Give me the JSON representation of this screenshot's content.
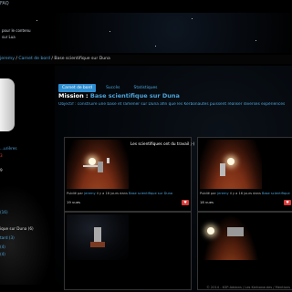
{
  "top": {
    "faq": "FAQ"
  },
  "hero": {
    "line1": "pour le contenu",
    "line2": "sur Lua"
  },
  "breadcrumb": {
    "first": "jeremy",
    "second": "Carnet de bord",
    "current": "Base scientifique sur Duna"
  },
  "sidebar": {
    "stats": [
      {
        "text": "...urières",
        "color": "blue"
      },
      {
        "text": "3",
        "color": "red"
      },
      {
        "text": "9",
        "color": "white"
      },
      {
        "text": "(16)",
        "color": "blue"
      },
      {
        "text": "ique sur Duna (6)",
        "color": "white"
      },
      {
        "text": "tard (3)",
        "color": "blue"
      },
      {
        "text": "(4)",
        "color": "blue"
      },
      {
        "text": "(4)",
        "color": "blue"
      }
    ]
  },
  "tabs": [
    "Carnet de bord",
    "Succès",
    "Statistiques"
  ],
  "mission": {
    "label": "Mission :",
    "name": "Base scientifique sur Duna"
  },
  "objectif": "Objectif : construire une base et ramener sur Duna afin que les Kerbonautes puissent réaliser diverses expériences",
  "cards": [
    {
      "caption": "Les scientifiques ont du travail ;-)",
      "posted_by": "Publié par",
      "author": "jeremy",
      "time": "il y a 16 jours dans",
      "album": "Base scientifique sur Duna",
      "views": "19 vues",
      "heart": "♥",
      "scene": "mars"
    },
    {
      "caption": "",
      "posted_by": "Publié par",
      "author": "jeremy",
      "time": "il y a 16 jours dans",
      "album": "Base scientifique",
      "views": "18 vues",
      "heart": "♥",
      "scene": "mars"
    },
    {
      "caption": "",
      "posted_by": "",
      "author": "",
      "time": "",
      "album": "",
      "views": "",
      "heart": "",
      "scene": "space"
    },
    {
      "caption": "",
      "posted_by": "",
      "author": "",
      "time": "",
      "album": "",
      "views": "",
      "heart": "",
      "scene": "space"
    }
  ],
  "footer": {
    "copyright": "© 2014 - KSP-Addons / Les Kerbonautes / Mentions"
  },
  "colors": {
    "accent": "#2f8ed0",
    "link": "#4ea3d8",
    "heart": "#d83a3a"
  }
}
